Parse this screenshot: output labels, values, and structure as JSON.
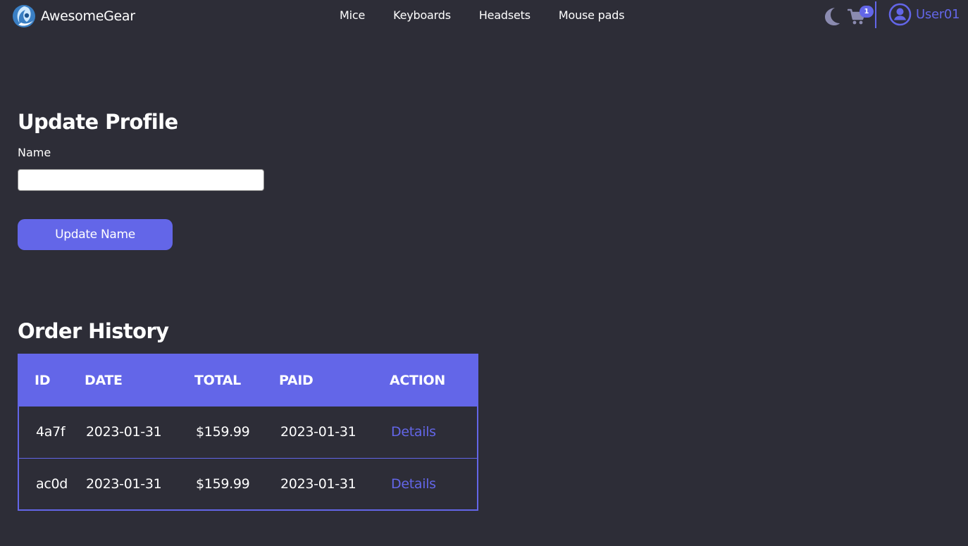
{
  "navbar": {
    "brand_name": "AwesomeGear",
    "links": [
      {
        "label": "Mice"
      },
      {
        "label": "Keyboards"
      },
      {
        "label": "Headsets"
      },
      {
        "label": "Mouse pads"
      }
    ],
    "theme_toggle_icon": "moon-icon",
    "cart_icon": "cart-icon",
    "cart_count": "1",
    "user_icon": "user-circle-icon",
    "user_name": "User01"
  },
  "profile": {
    "title": "Update Profile",
    "name_label": "Name",
    "name_value": "",
    "update_button_label": "Update Name"
  },
  "orders": {
    "title": "Order History",
    "columns": [
      "ID",
      "DATE",
      "TOTAL",
      "PAID",
      "ACTION"
    ],
    "rows": [
      {
        "id": "4a7f",
        "date": "2023-01-31",
        "total": "$159.99",
        "paid": "2023-01-31",
        "action": "Details"
      },
      {
        "id": "ac0d",
        "date": "2023-01-31",
        "total": "$159.99",
        "paid": "2023-01-31",
        "action": "Details"
      }
    ]
  },
  "colors": {
    "background": "#2d2d37",
    "accent": "#6366e8",
    "text": "#ffffff",
    "icon_muted": "#8b8bb0"
  }
}
